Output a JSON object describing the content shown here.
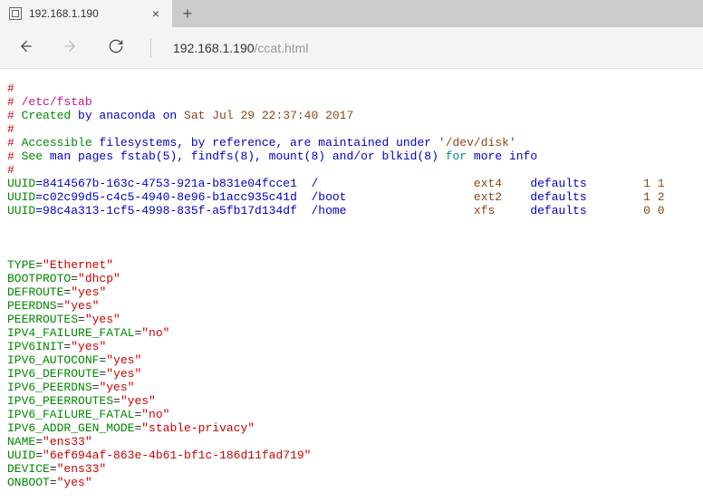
{
  "tab": {
    "title": "192.168.1.190",
    "close": "×",
    "new": "+"
  },
  "url": {
    "host": "192.168.1.190",
    "path": "/ccat.html"
  },
  "fstab": {
    "h": [
      "#",
      "# ",
      "/etc/fstab",
      "# ",
      "Created",
      " by anaconda on ",
      "Sat Jul 29 22:37:40 2017",
      "#",
      "# ",
      "Accessible",
      " filesystems, by reference, are maintained under ",
      "'/dev/disk'",
      "# ",
      "See",
      " man pages fstab(5), findfs(8), mount(8) and/or blkid(8) ",
      "for",
      " more info",
      "#"
    ],
    "rows": [
      {
        "k": "UUID",
        "v": "=8414567b-163c-4753-921a-b831e04fcce1",
        "mnt": "/",
        "fs": "ext4",
        "opt": "defaults",
        "n": "1 1"
      },
      {
        "k": "UUID",
        "v": "=c02c99d5-c4c5-4940-8e96-b1acc935c41d",
        "mnt": "/boot",
        "fs": "ext2",
        "opt": "defaults",
        "n": "1 2"
      },
      {
        "k": "UUID",
        "v": "=98c4a313-1cf5-4998-835f-a5fb17d134df",
        "mnt": "/home",
        "fs": "xfs",
        "opt": "defaults",
        "n": "0 0"
      }
    ]
  },
  "ifcfg": [
    {
      "k": "TYPE",
      "v": "\"Ethernet\""
    },
    {
      "k": "BOOTPROTO",
      "v": "\"dhcp\""
    },
    {
      "k": "DEFROUTE",
      "v": "\"yes\""
    },
    {
      "k": "PEERDNS",
      "v": "\"yes\""
    },
    {
      "k": "PEERROUTES",
      "v": "\"yes\""
    },
    {
      "k": "IPV4_FAILURE_FATAL",
      "v": "\"no\""
    },
    {
      "k": "IPV6INIT",
      "v": "\"yes\""
    },
    {
      "k": "IPV6_AUTOCONF",
      "v": "\"yes\""
    },
    {
      "k": "IPV6_DEFROUTE",
      "v": "\"yes\""
    },
    {
      "k": "IPV6_PEERDNS",
      "v": "\"yes\""
    },
    {
      "k": "IPV6_PEERROUTES",
      "v": "\"yes\""
    },
    {
      "k": "IPV6_FAILURE_FATAL",
      "v": "\"no\""
    },
    {
      "k": "IPV6_ADDR_GEN_MODE",
      "v": "\"stable-privacy\""
    },
    {
      "k": "NAME",
      "v": "\"ens33\""
    },
    {
      "k": "UUID",
      "v": "\"6ef694af-863e-4b61-bf1c-186d11fad719\""
    },
    {
      "k": "DEVICE",
      "v": "\"ens33\""
    },
    {
      "k": "ONBOOT",
      "v": "\"yes\""
    }
  ]
}
